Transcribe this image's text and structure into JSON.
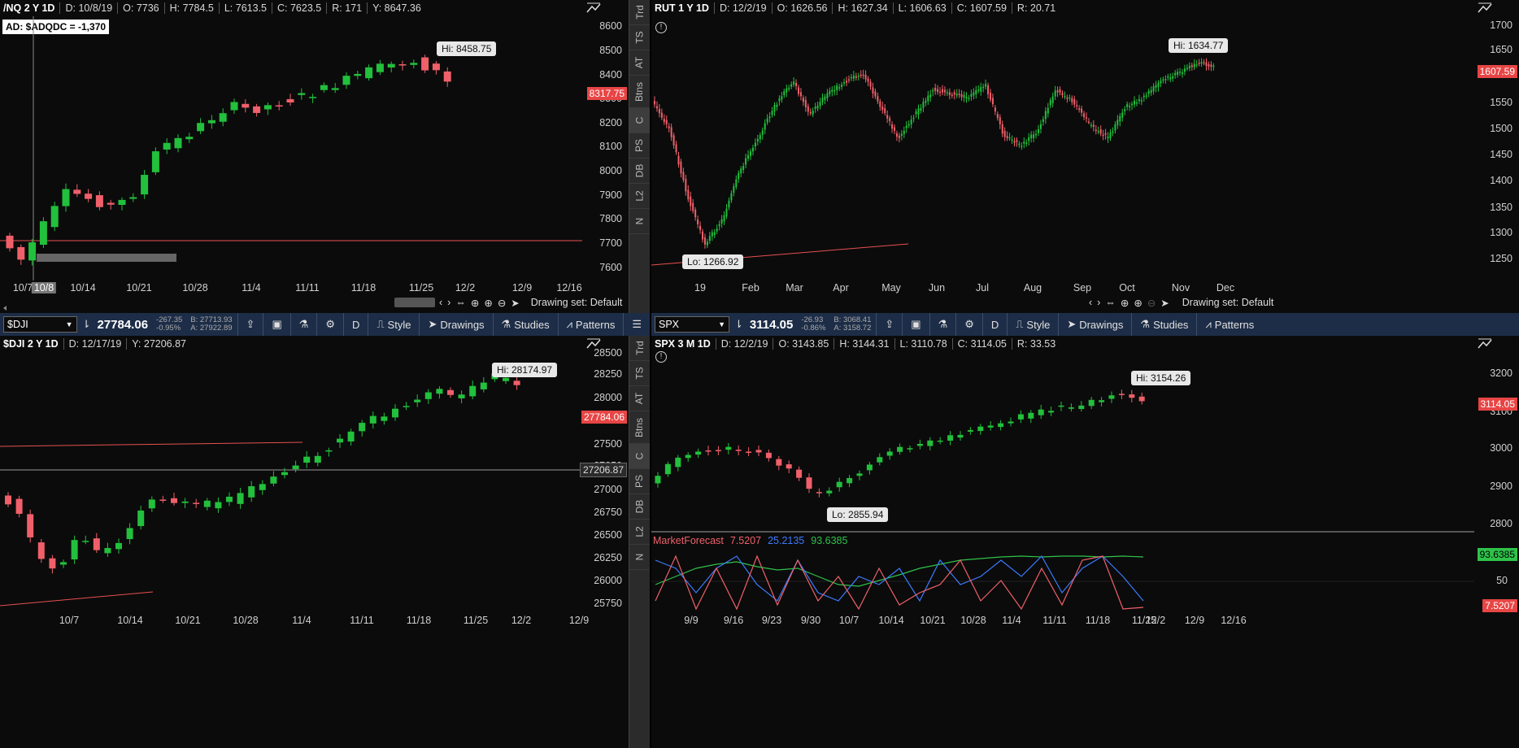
{
  "panels": {
    "nq": {
      "symbol": "/NQ 2 Y 1D",
      "cells": [
        "D: 10/8/19",
        "O: 7736",
        "H: 7784.5",
        "L: 7613.5",
        "C: 7623.5",
        "R: 171",
        "Y: 8647.36"
      ],
      "ad_label": "AD: $ADQDC = -1,370",
      "y_ticks": [
        "8600",
        "8500",
        "8400",
        "8300",
        "8200",
        "8100",
        "8000",
        "7900",
        "7800",
        "7700",
        "7600"
      ],
      "x_ticks": [
        "10/7",
        "10/8",
        "10/14",
        "10/21",
        "10/28",
        "11/4",
        "11/11",
        "11/18",
        "11/25",
        "12/2",
        "12/9",
        "12/16"
      ],
      "hi": "Hi: 8458.75",
      "price": "8317.75",
      "drawing_set": "Drawing set: Default"
    },
    "rut": {
      "symbol": "RUT 1 Y 1D",
      "cells": [
        "D: 12/2/19",
        "O: 1626.56",
        "H: 1627.34",
        "L: 1606.63",
        "C: 1607.59",
        "R: 20.71"
      ],
      "y_ticks": [
        "1700",
        "1650",
        "1600",
        "1550",
        "1500",
        "1450",
        "1400",
        "1350",
        "1300",
        "1250"
      ],
      "x_ticks": [
        "19",
        "Feb",
        "Mar",
        "Apr",
        "May",
        "Jun",
        "Jul",
        "Aug",
        "Sep",
        "Oct",
        "Nov",
        "Dec"
      ],
      "hi": "Hi: 1634.77",
      "lo": "Lo: 1266.92",
      "price": "1607.59",
      "drawing_set": "Drawing set: Default"
    },
    "dji": {
      "symbol": "$DJI 2 Y 1D",
      "cells": [
        "D: 12/17/19",
        "Y: 27206.87"
      ],
      "y_ticks": [
        "28500",
        "28250",
        "28000",
        "27750",
        "27500",
        "27250",
        "27000",
        "26750",
        "26500",
        "26250",
        "26000",
        "25750"
      ],
      "x_ticks": [
        "10/7",
        "10/14",
        "10/21",
        "10/28",
        "11/4",
        "11/11",
        "11/18",
        "11/25",
        "12/2",
        "12/9"
      ],
      "hi": "Hi: 28174.97",
      "price": "27784.06",
      "cursor_price": "27206.87"
    },
    "spx": {
      "symbol": "SPX 3 M 1D",
      "cells": [
        "D: 12/2/19",
        "O: 3143.85",
        "H: 3144.31",
        "L: 3110.78",
        "C: 3114.05",
        "R: 33.53"
      ],
      "y_ticks": [
        "3200",
        "3100",
        "3000",
        "2900",
        "2800"
      ],
      "x_ticks": [
        "9/9",
        "9/16",
        "9/23",
        "9/30",
        "10/7",
        "10/14",
        "10/21",
        "10/28",
        "11/4",
        "11/11",
        "11/18",
        "11/25",
        "12/2",
        "12/9",
        "12/16"
      ],
      "hi": "Hi: 3154.26",
      "lo": "Lo: 2855.94",
      "price": "3114.05",
      "study": {
        "name": "MarketForecast",
        "v1": "7.5207",
        "v2": "25.2135",
        "v3": "93.6385",
        "tick": "50"
      }
    }
  },
  "toolbars": {
    "left": {
      "symbol": "$DJI",
      "last": "27784.06",
      "chg": "-267.35",
      "pct": "-0.95%",
      "bid": "B: 27713.93",
      "ask": "A: 27922.89"
    },
    "right": {
      "symbol": "SPX",
      "last": "3114.05",
      "chg": "-26.93",
      "pct": "-0.86%",
      "bid": "B: 3068.41",
      "ask": "A: 3158.72"
    },
    "period": "D",
    "style": "Style",
    "drawings": "Drawings",
    "studies": "Studies",
    "patterns": "Patterns"
  },
  "sidebar": [
    "Trd",
    "TS",
    "AT",
    "Btns",
    "C",
    "PS",
    "DB",
    "L2",
    "N"
  ],
  "colors": {
    "up": "#22c03c",
    "down": "#f0606a",
    "accent": "#1d2d47",
    "bg": "#0b0b0b"
  }
}
